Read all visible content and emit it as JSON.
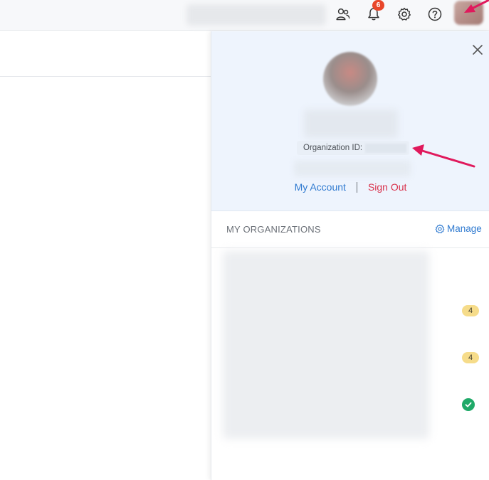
{
  "topbar": {
    "icons": [
      "users-icon",
      "bell-icon",
      "gear-icon",
      "help-icon"
    ],
    "notification_count": "6"
  },
  "profile": {
    "organization_id_label": "Organization ID:",
    "my_account_label": "My Account",
    "sign_out_label": "Sign Out"
  },
  "organizations": {
    "title": "MY ORGANIZATIONS",
    "manage_label": "Manage",
    "items": [
      {
        "badge": ""
      },
      {
        "badge": "4"
      },
      {
        "badge": "4"
      },
      {
        "badge": "check"
      }
    ]
  },
  "colors": {
    "accent": "#2f7ad0",
    "danger": "#d9334d",
    "badge_yellow": "#f6dc8a",
    "success": "#1fa968",
    "annotation_arrow": "#e0195c"
  }
}
